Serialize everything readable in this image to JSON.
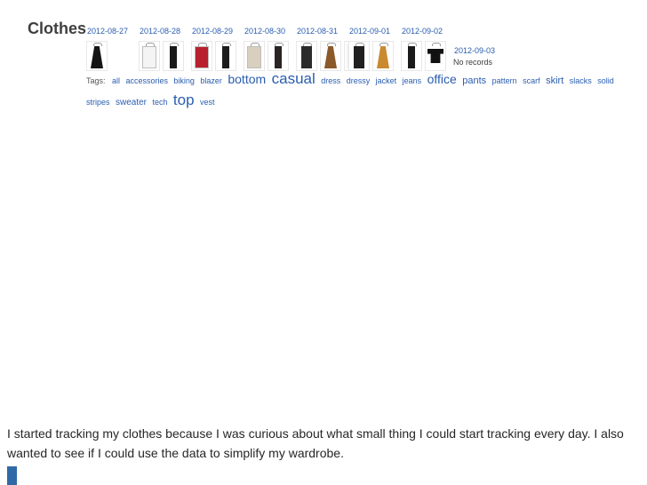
{
  "title": "Clothes",
  "days": [
    {
      "date": "2012-08-27",
      "items": [
        {
          "color": "#151515",
          "kind": "dress"
        }
      ]
    },
    {
      "date": "2012-08-28",
      "items": [
        {
          "color": "#f4f4f4",
          "kind": "shirt"
        },
        {
          "color": "#1a1a1a",
          "kind": "pants"
        }
      ]
    },
    {
      "date": "2012-08-29",
      "items": [
        {
          "color": "#b8202e",
          "kind": "shirt"
        },
        {
          "color": "#1c1c1c",
          "kind": "pants"
        }
      ]
    },
    {
      "date": "2012-08-30",
      "items": [
        {
          "color": "#d9cfbe",
          "kind": "blazer"
        },
        {
          "color": "#2a2522",
          "kind": "pants"
        }
      ]
    },
    {
      "date": "2012-08-31",
      "items": [
        {
          "color": "#2b2b2b",
          "kind": "top"
        },
        {
          "color": "#8a5a2a",
          "kind": "skirt"
        },
        {
          "color": "unknown",
          "kind": "unknown"
        }
      ]
    },
    {
      "date": "2012-09-01",
      "items": [
        {
          "color": "#202020",
          "kind": "top"
        },
        {
          "color": "#c98a30",
          "kind": "skirt"
        }
      ]
    },
    {
      "date": "2012-09-02",
      "items": [
        {
          "color": "#1a1a1a",
          "kind": "pants"
        },
        {
          "color": "#111111",
          "kind": "tshirt"
        }
      ]
    }
  ],
  "no_records": {
    "date": "2012-09-03",
    "status": "No records"
  },
  "tags_label": "Tags:",
  "tags": [
    {
      "text": "all",
      "size": 9
    },
    {
      "text": "accessories",
      "size": 9
    },
    {
      "text": "biking",
      "size": 9
    },
    {
      "text": "blazer",
      "size": 9
    },
    {
      "text": "bottom",
      "size": 14
    },
    {
      "text": "casual",
      "size": 17
    },
    {
      "text": "dress",
      "size": 9
    },
    {
      "text": "dressy",
      "size": 9
    },
    {
      "text": "jacket",
      "size": 9
    },
    {
      "text": "jeans",
      "size": 9
    },
    {
      "text": "office",
      "size": 14
    },
    {
      "text": "pants",
      "size": 11
    },
    {
      "text": "pattern",
      "size": 9
    },
    {
      "text": "scarf",
      "size": 9
    },
    {
      "text": "skirt",
      "size": 11
    },
    {
      "text": "slacks",
      "size": 9
    },
    {
      "text": "solid",
      "size": 9
    },
    {
      "text": "stripes",
      "size": 9
    },
    {
      "text": "sweater",
      "size": 10
    },
    {
      "text": "tech",
      "size": 9
    },
    {
      "text": "top",
      "size": 17
    },
    {
      "text": "vest",
      "size": 9
    }
  ],
  "caption": "I started tracking my clothes because I was curious about what small thing I could start tracking every day. I also wanted to see if I could use the data to simplify my wardrobe."
}
